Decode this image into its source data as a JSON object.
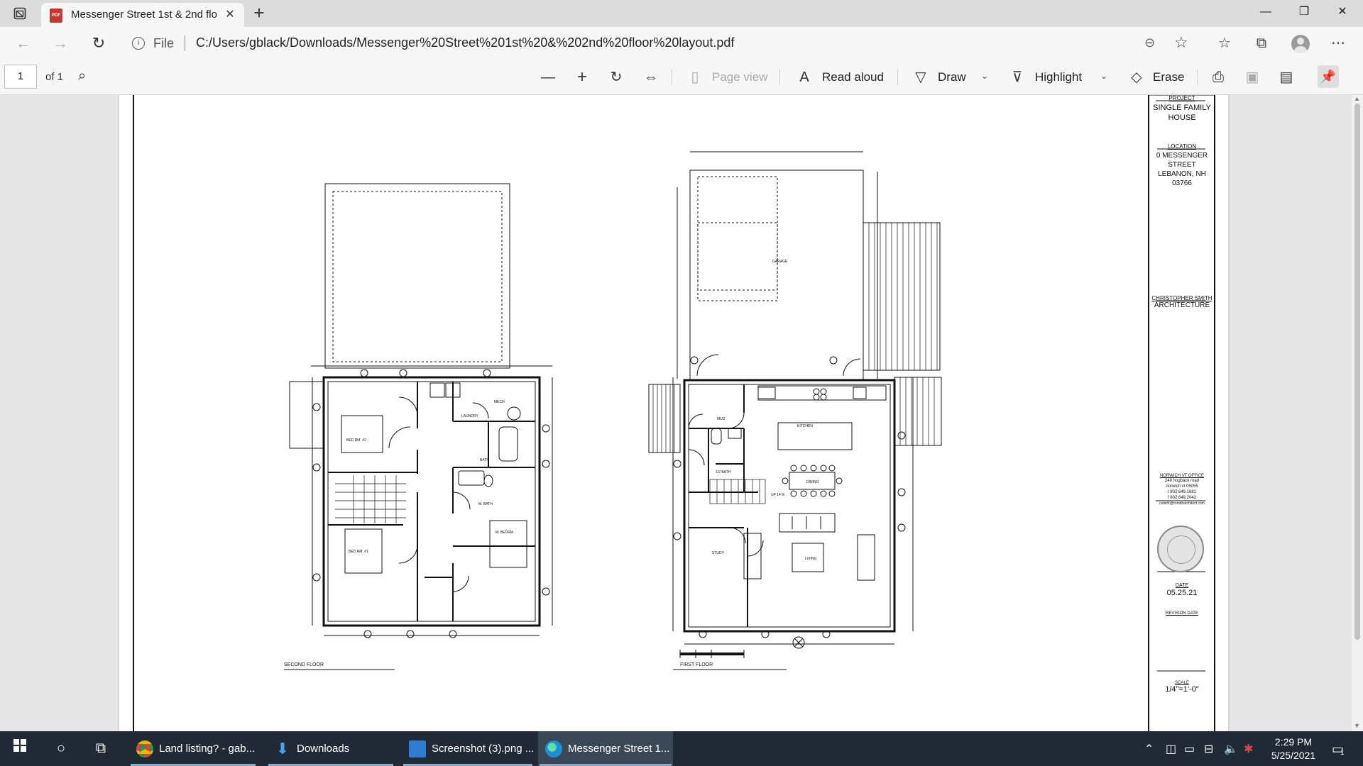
{
  "browser": {
    "tab_title": "Messenger Street 1st & 2nd floo",
    "tab_icon": "pdf-icon",
    "scheme": "File",
    "url": "C:/Users/gblack/Downloads/Messenger%20Street%201st%20&%202nd%20floor%20layout.pdf"
  },
  "pdf_toolbar": {
    "page_number": "1",
    "page_of": "of 1",
    "page_view": "Page view",
    "read_aloud": "Read aloud",
    "draw": "Draw",
    "highlight": "Highlight",
    "erase": "Erase"
  },
  "drawing": {
    "second_floor_label": "SECOND FLOOR",
    "first_floor_label": "FIRST FLOOR",
    "title_block": {
      "project_head": "PROJECT",
      "project": [
        "SINGLE FAMILY",
        "HOUSE"
      ],
      "location_head": "LOCATION",
      "location": [
        "0 MESSENGER",
        "STREET",
        "LEBANON, NH",
        "03766"
      ],
      "firm": [
        "CHRISTOPHER SMITH",
        "ARCHITECTURE"
      ],
      "office_head": "NORWICH VT OFFICE",
      "office": [
        "248 hogback road",
        "norwich vt 05055",
        "t  802.649.1681",
        "f  802.649.2042",
        "csmith@csmitharchitect.com"
      ],
      "date_head": "DATE",
      "date": "05.25.21",
      "revision_head": "REVISION DATE",
      "scale_head": "SCALE",
      "scale": "1/4\"=1'-0\""
    }
  },
  "taskbar": {
    "apps": [
      {
        "label": "Land listing? - gab...",
        "icon": "chrome-gmail-icon"
      },
      {
        "label": "Downloads",
        "icon": "download-folder-icon"
      },
      {
        "label": "Screenshot (3).png ...",
        "icon": "photos-icon"
      },
      {
        "label": "Messenger Street 1...",
        "icon": "edge-icon"
      }
    ],
    "time": "2:29 PM",
    "date": "5/25/2021",
    "notification_count": "1"
  }
}
